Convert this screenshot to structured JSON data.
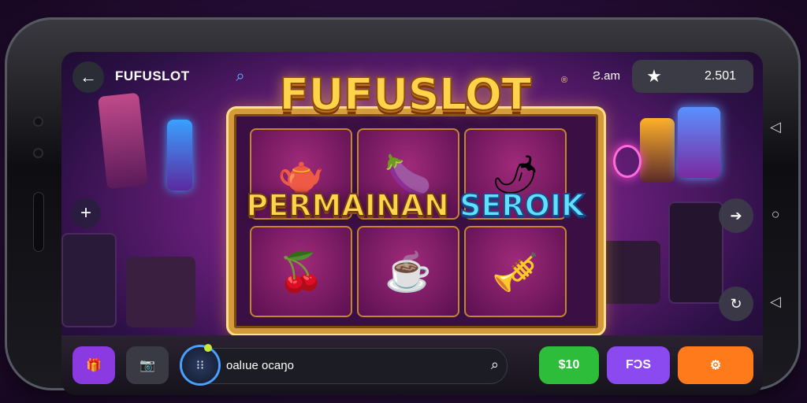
{
  "topbar": {
    "back_icon": "arrow-left-icon",
    "title": "FUFUSLOT",
    "search_icon": "search-icon",
    "user_label": "Ƨ.am",
    "star_icon": "star-icon",
    "coins": "2.501"
  },
  "game": {
    "logo": "FUFUSLOT",
    "logo_mark": "®",
    "banner_part1": "PERMAINAN",
    "banner_part2": "SEROIK",
    "reels": [
      "teapot-icon",
      "eggplant-icon",
      "chili-heart-icon",
      "fruit-bowl-icon",
      "teacup-icon",
      "golden-horn-icon"
    ]
  },
  "side": {
    "plus": "+",
    "forward": "➔",
    "refresh": "↻"
  },
  "bottombar": {
    "gift_icon": "gift-icon",
    "camera_icon": "camera-icon",
    "chat_text": "oalıue ocaŋo",
    "chat_search_icon": "search-icon",
    "green_label": "$10",
    "purple_label": "FƆS",
    "orange_icon": "settings-icon"
  },
  "colors": {
    "accent_gold": "#ffd44a",
    "green_btn": "#2ebd3a",
    "purple_btn": "#8a4af0",
    "orange_btn": "#ff7a1a"
  }
}
